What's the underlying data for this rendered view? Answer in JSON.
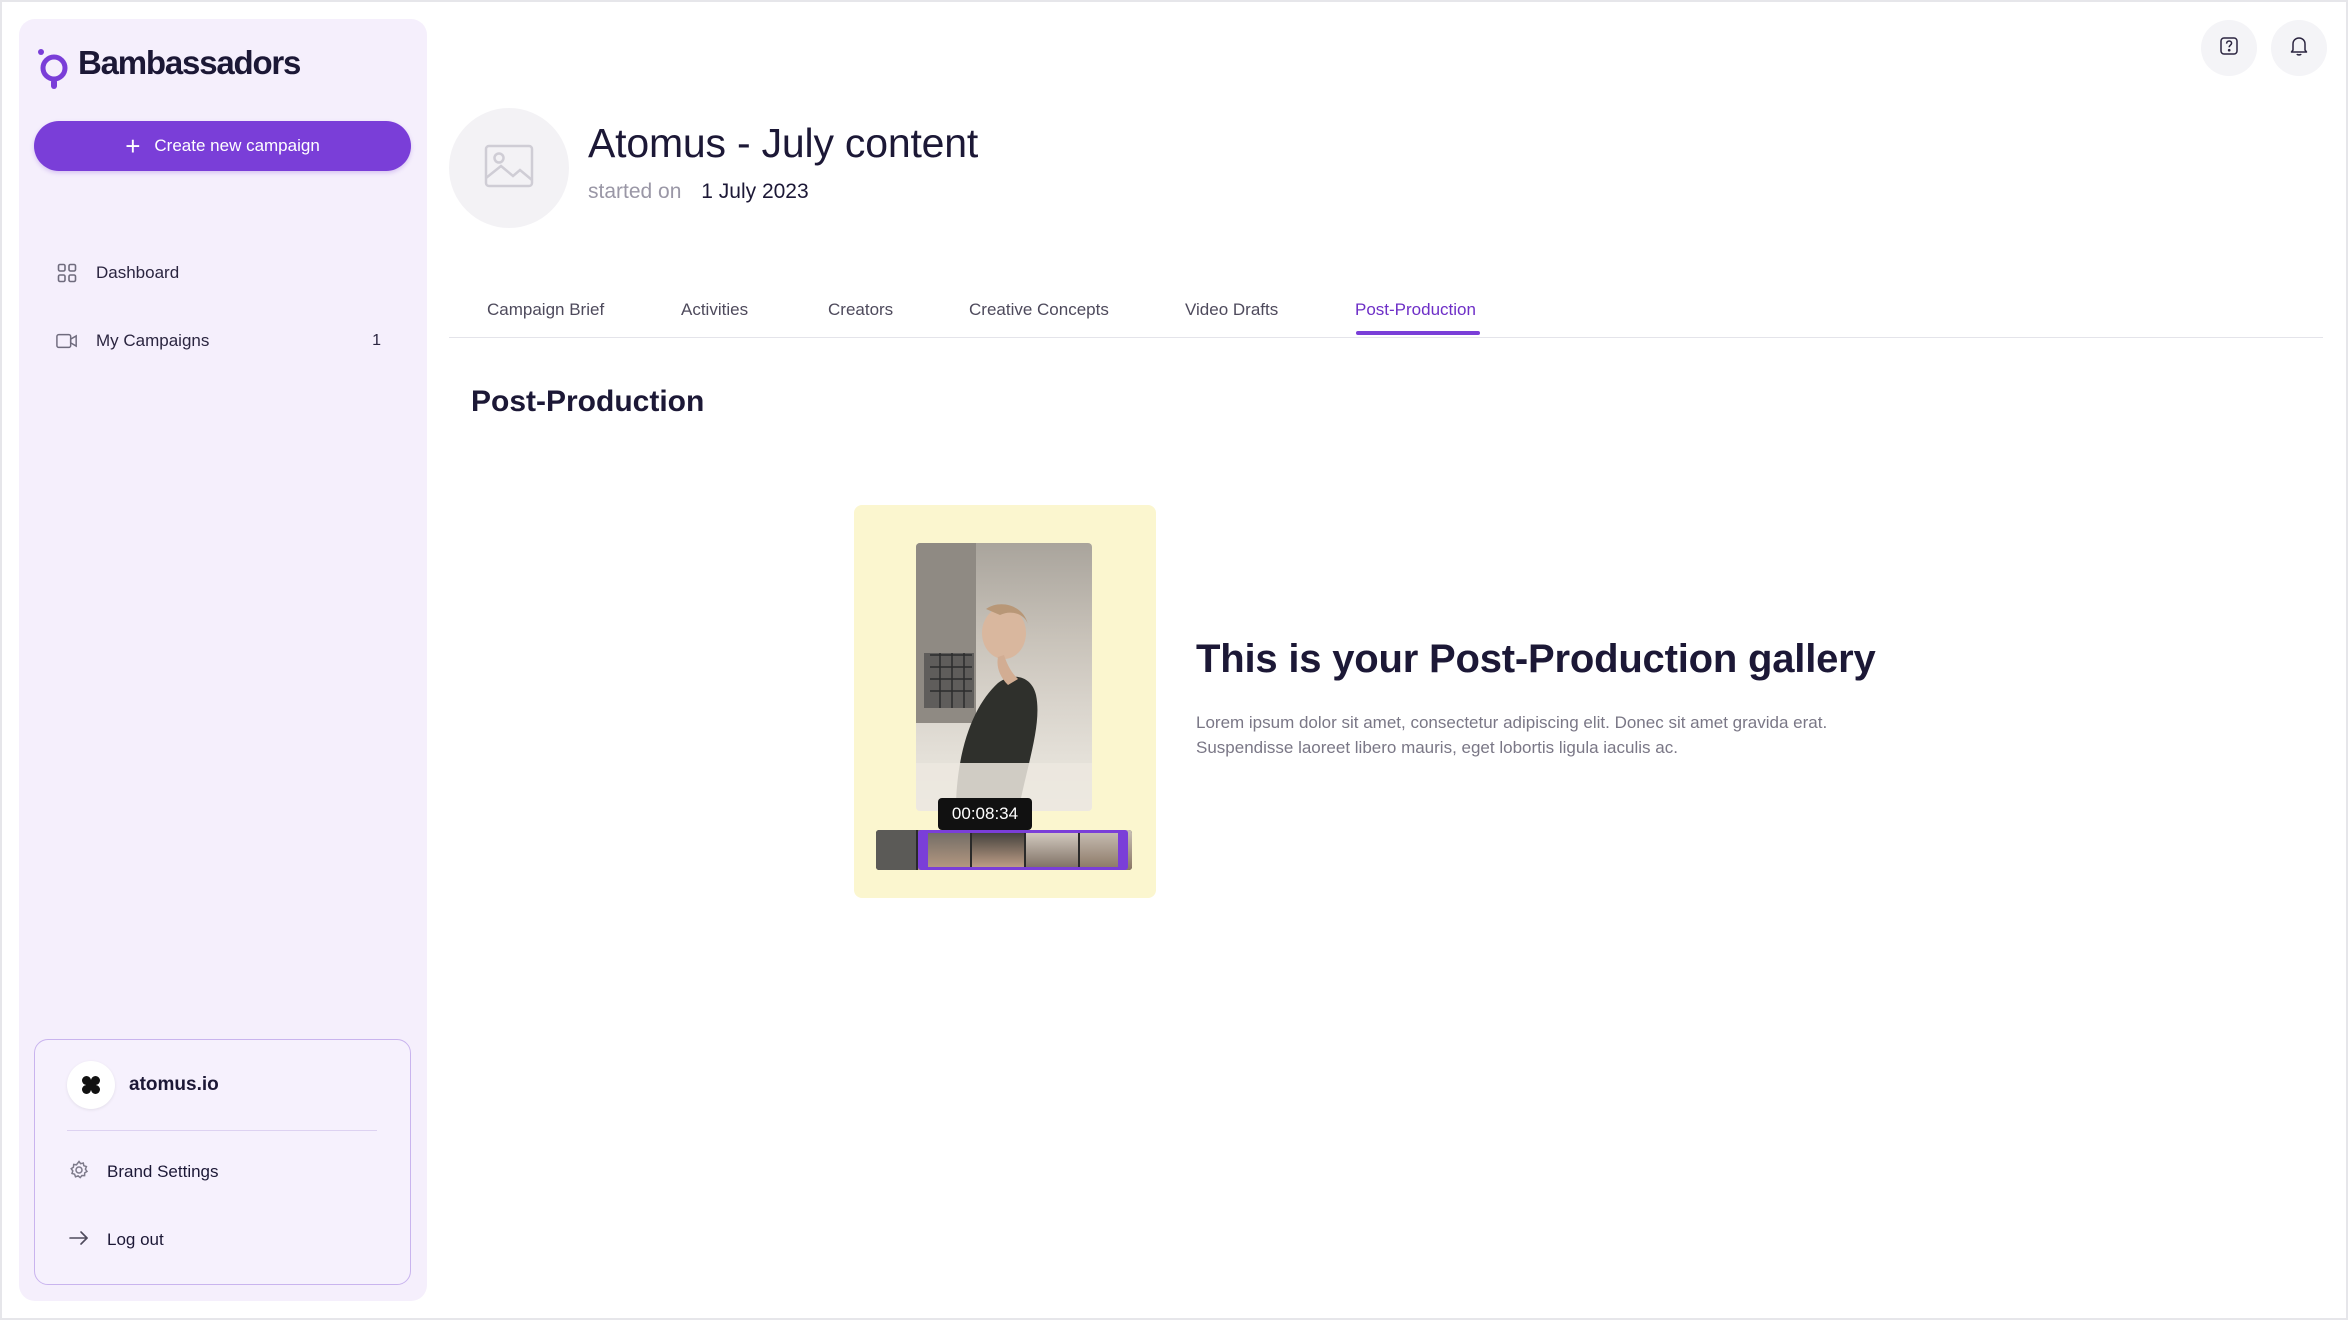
{
  "brand": {
    "name": "Bambassadors",
    "accent": "#7a3ed8"
  },
  "sidebar": {
    "create_label": "Create new campaign",
    "items": [
      {
        "label": "Dashboard",
        "icon": "grid-icon",
        "badge": ""
      },
      {
        "label": "My Campaigns",
        "icon": "video-camera-icon",
        "badge": "1"
      }
    ],
    "account": {
      "name": "atomus.io",
      "brand_settings_label": "Brand Settings",
      "logout_label": "Log out"
    }
  },
  "header": {
    "title": "Atomus - July content",
    "started_label": "started on",
    "started_date": "1 July 2023"
  },
  "tabs": [
    {
      "label": "Campaign Brief",
      "active": false
    },
    {
      "label": "Activities",
      "active": false
    },
    {
      "label": "Creators",
      "active": false
    },
    {
      "label": "Creative Concepts",
      "active": false
    },
    {
      "label": "Video Drafts",
      "active": false
    },
    {
      "label": "Post-Production",
      "active": true
    }
  ],
  "section": {
    "title": "Post-Production"
  },
  "gallery": {
    "timestamp": "00:08:34",
    "heading": "This is your Post-Production gallery",
    "description": "Lorem ipsum dolor sit amet, consectetur adipiscing elit. Donec sit amet gravida erat. Suspendisse laoreet libero mauris, eget lobortis ligula iaculis ac."
  }
}
